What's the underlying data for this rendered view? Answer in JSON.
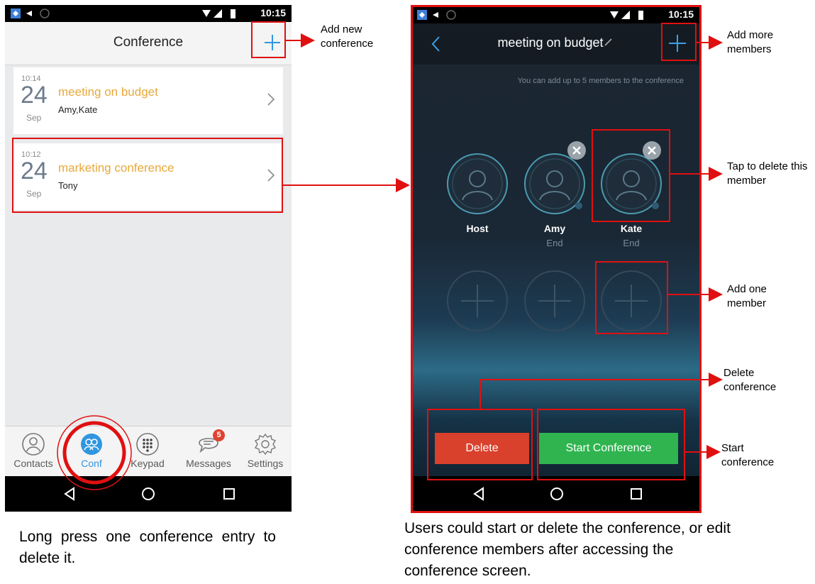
{
  "status_bar": {
    "time": "10:15"
  },
  "left_screen": {
    "title": "Conference",
    "conferences": [
      {
        "time": "10:14",
        "day": "24",
        "month": "Sep",
        "name": "meeting on budget",
        "members": "Amy,Kate"
      },
      {
        "time": "10:12",
        "day": "24",
        "month": "Sep",
        "name": "marketing conference",
        "members": "Tony"
      }
    ],
    "tabs": [
      {
        "label": "Contacts",
        "icon": "person-icon"
      },
      {
        "label": "Conf",
        "icon": "conference-icon"
      },
      {
        "label": "Keypad",
        "icon": "keypad-icon"
      },
      {
        "label": "Messages",
        "icon": "messages-icon",
        "badge": "5"
      },
      {
        "label": "Settings",
        "icon": "gear-icon"
      }
    ],
    "active_tab": "Conf"
  },
  "right_screen": {
    "title": "meeting on budget",
    "hint": "You can add up to 5 members to the conference",
    "members": [
      {
        "name": "Host",
        "status": ""
      },
      {
        "name": "Amy",
        "status": "End"
      },
      {
        "name": "Kate",
        "status": "End"
      }
    ],
    "delete_label": "Delete",
    "start_label": "Start Conference"
  },
  "annotations": {
    "add_new_conference": "Add new conference",
    "add_more_members": "Add more members",
    "tap_to_delete": "Tap to delete this  member",
    "add_one_member": "Add one member",
    "delete_conference": "Delete conference",
    "start_conference": "Start conference"
  },
  "captions": {
    "left": "Long press one conference entry to delete it.",
    "right": "Users could start or delete the conference, or edit conference members after accessing the conference screen."
  },
  "colors": {
    "accent_orange": "#e8a83a",
    "active_blue": "#2f96e0",
    "delete_red": "#d9412d",
    "start_green": "#2fb44f",
    "annotation_red": "#e01010"
  }
}
